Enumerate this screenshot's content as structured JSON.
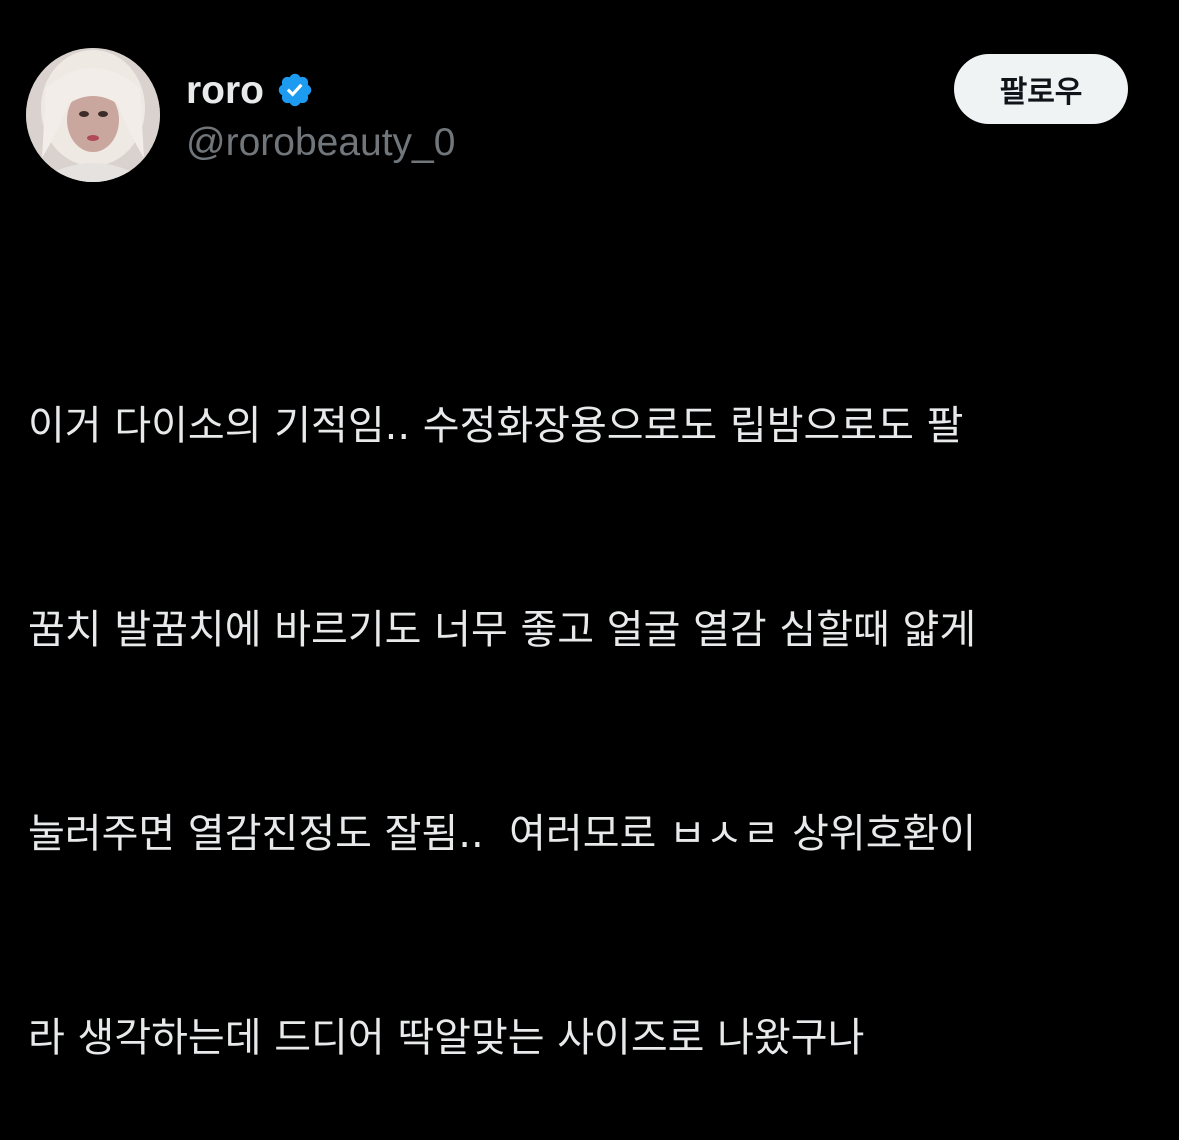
{
  "author": {
    "display_name": "roro",
    "handle": "@rorobeauty_0",
    "verified": true,
    "verified_color": "#1d9bf0",
    "avatar_icon": "avatar-photo"
  },
  "follow_button": {
    "label": "팔로우"
  },
  "tweet": {
    "lines": [
      "이거 다이소의 기적임.. 수정화장용으로도 립밤으로도 팔",
      "꿈치 발꿈치에 바르기도 너무 좋고 얼굴 열감 심할때 얇게",
      "눌러주면 열감진정도 잘됨..  여러모로 ㅂㅅㄹ 상위호환이",
      "라 생각하는데 드디어 딱알맞는 사이즈로 나왔구나"
    ]
  },
  "colors": {
    "background": "#000000",
    "primary_text": "#e7e9ea",
    "secondary_text": "#71767b",
    "button_bg": "#eff3f4"
  }
}
